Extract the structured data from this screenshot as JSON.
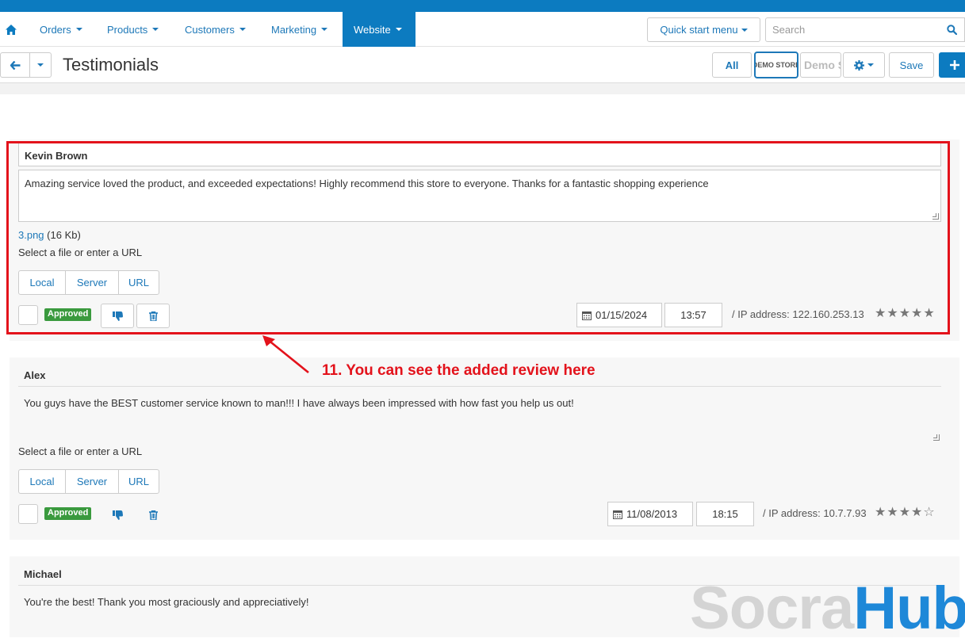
{
  "nav": {
    "items": [
      {
        "label": "Orders"
      },
      {
        "label": "Products"
      },
      {
        "label": "Customers"
      },
      {
        "label": "Marketing"
      },
      {
        "label": "Website"
      }
    ],
    "quick_start_label": "Quick start menu",
    "search_placeholder": "Search"
  },
  "toolbar": {
    "title": "Testimonials",
    "all_label": "All",
    "store1_label": "DEMO STORE",
    "store2_label": "Demo Sto",
    "save_label": "Save"
  },
  "reviews": [
    {
      "author": "Kevin Brown",
      "message": "Amazing service loved the product, and exceeded expectations! Highly recommend this store to everyone. Thanks for a fantastic shopping experience",
      "file_name": "3.png",
      "file_size": "(16 Kb)",
      "select_file": "Select a file or enter a URL",
      "sources": [
        "Local",
        "Server",
        "URL"
      ],
      "status": "Approved",
      "date": "01/15/2024",
      "time": "13:57",
      "ip": "/ IP address: 122.160.253.13",
      "rating": 5,
      "stars": "★★★★★"
    },
    {
      "author": "Alex",
      "message": "You guys have the BEST customer service known to man!!! I have always been impressed with how fast you help us out!",
      "select_file": "Select a file or enter a URL",
      "sources": [
        "Local",
        "Server",
        "URL"
      ],
      "status": "Approved",
      "date": "11/08/2013",
      "time": "18:15",
      "ip": "/ IP address: 10.7.7.93",
      "rating": 4,
      "stars": "★★★★☆"
    },
    {
      "author": "Michael",
      "message": "You're the best! Thank you most graciously and appreciatively!"
    }
  ],
  "annotation": "11. You can see the added review here",
  "watermark": {
    "part1": "Socra",
    "part2": "Hub"
  },
  "colors": {
    "brand_blue": "#0c7bc0",
    "link_blue": "#1d78b8",
    "approved_green": "#3a9a3e",
    "annotation_red": "#e3121b",
    "watermark_blue": "#1e88d8"
  }
}
